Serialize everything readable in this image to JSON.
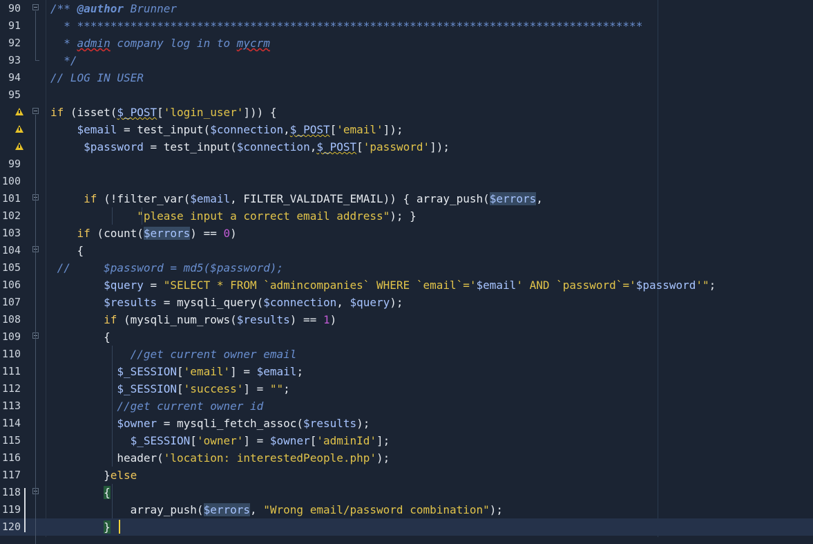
{
  "editor": {
    "lines": [
      {
        "n": "90",
        "warn": false,
        "html": "<span class=\"c\">/** <b>@author</b> Brunner</span>"
      },
      {
        "n": "91",
        "warn": false,
        "html": "<span class=\"c\">  * *************************************************************************************</span>"
      },
      {
        "n": "92",
        "warn": false,
        "html": "<span class=\"c\">  * <span class=\"wavy-red\">admin</span> company log in to <span class=\"wavy-red\">mycrm</span></span>"
      },
      {
        "n": "93",
        "warn": false,
        "html": "<span class=\"c\">  */</span>"
      },
      {
        "n": "94",
        "warn": false,
        "html": "<span class=\"c\">// LOG IN USER</span>"
      },
      {
        "n": "95",
        "warn": false,
        "html": ""
      },
      {
        "n": "",
        "warn": true,
        "html": "<span class=\"kw\">if</span> (isset(<span class=\"v wavy\">$_POST</span>[<span class=\"s\">'login_user'</span>])) {"
      },
      {
        "n": "",
        "warn": true,
        "html": "    <span class=\"v\">$email</span> = test_input(<span class=\"v\">$connection</span>,<span class=\"v wavy\">$_POST</span>[<span class=\"s\">'email'</span>]);"
      },
      {
        "n": "",
        "warn": true,
        "html": "     <span class=\"v\">$password</span> = test_input(<span class=\"v\">$connection</span>,<span class=\"v wavy\">$_POST</span>[<span class=\"s\">'password'</span>]);"
      },
      {
        "n": "99",
        "warn": false,
        "html": ""
      },
      {
        "n": "100",
        "warn": false,
        "html": ""
      },
      {
        "n": "101",
        "warn": false,
        "html": "     <span class=\"kw\">if</span> (!filter_var(<span class=\"v\">$email</span>, FILTER_VALIDATE_EMAIL)) { array_push(<span class=\"v hl\">$errors</span>,"
      },
      {
        "n": "102",
        "warn": false,
        "html": "             <span class=\"s\">\"please input a correct email address\"</span>); }"
      },
      {
        "n": "103",
        "warn": false,
        "html": "    <span class=\"kw\">if</span> (count(<span class=\"v hl\">$errors</span>) == <span class=\"num\">0</span>)"
      },
      {
        "n": "104",
        "warn": false,
        "html": "    {"
      },
      {
        "n": "105",
        "warn": false,
        "html": "<span class=\"c\"> //     $password = md5($password);</span>"
      },
      {
        "n": "106",
        "warn": false,
        "html": "        <span class=\"v\">$query</span> = <span class=\"s\">\"SELECT * FROM `admincompanies` WHERE `email`='</span><span class=\"v\">$email</span><span class=\"s\">' AND `password`='</span><span class=\"v\">$password</span><span class=\"s\">'\"</span>;"
      },
      {
        "n": "107",
        "warn": false,
        "html": "        <span class=\"v\">$results</span> = mysqli_query(<span class=\"v\">$connection</span>, <span class=\"v\">$query</span>);"
      },
      {
        "n": "108",
        "warn": false,
        "html": "        <span class=\"kw\">if</span> (mysqli_num_rows(<span class=\"v\">$results</span>) == <span class=\"num\">1</span>)"
      },
      {
        "n": "109",
        "warn": false,
        "html": "        {"
      },
      {
        "n": "110",
        "warn": false,
        "html": "<span class=\"c\">            //get current owner email</span>"
      },
      {
        "n": "111",
        "warn": false,
        "html": "          <span class=\"v\">$_SESSION</span>[<span class=\"s\">'email'</span>] = <span class=\"v\">$email</span>;"
      },
      {
        "n": "112",
        "warn": false,
        "html": "          <span class=\"v\">$_SESSION</span>[<span class=\"s\">'success'</span>] = <span class=\"s\">\"\"</span>;"
      },
      {
        "n": "113",
        "warn": false,
        "html": "<span class=\"c\">          //get current owner id</span>"
      },
      {
        "n": "114",
        "warn": false,
        "html": "          <span class=\"v\">$owner</span> = mysqli_fetch_assoc(<span class=\"v\">$results</span>);"
      },
      {
        "n": "115",
        "warn": false,
        "html": "            <span class=\"v\">$_SESSION</span>[<span class=\"s\">'owner'</span>] = <span class=\"v\">$owner</span>[<span class=\"s\">'adminId'</span>];"
      },
      {
        "n": "116",
        "warn": false,
        "html": "          header(<span class=\"s\">'location: interestedPeople.php'</span>);"
      },
      {
        "n": "117",
        "warn": false,
        "html": "        }<span class=\"kw\">else</span>"
      },
      {
        "n": "118",
        "warn": false,
        "html": "        <span class=\"brace-hl\">{</span>"
      },
      {
        "n": "119",
        "warn": false,
        "html": "            array_push(<span class=\"v hl\">$errors</span>, <span class=\"s\">\"Wrong email/password combination\"</span>);"
      },
      {
        "n": "120",
        "warn": false,
        "html": "        <span class=\"brace-hl\">}</span>"
      }
    ]
  }
}
